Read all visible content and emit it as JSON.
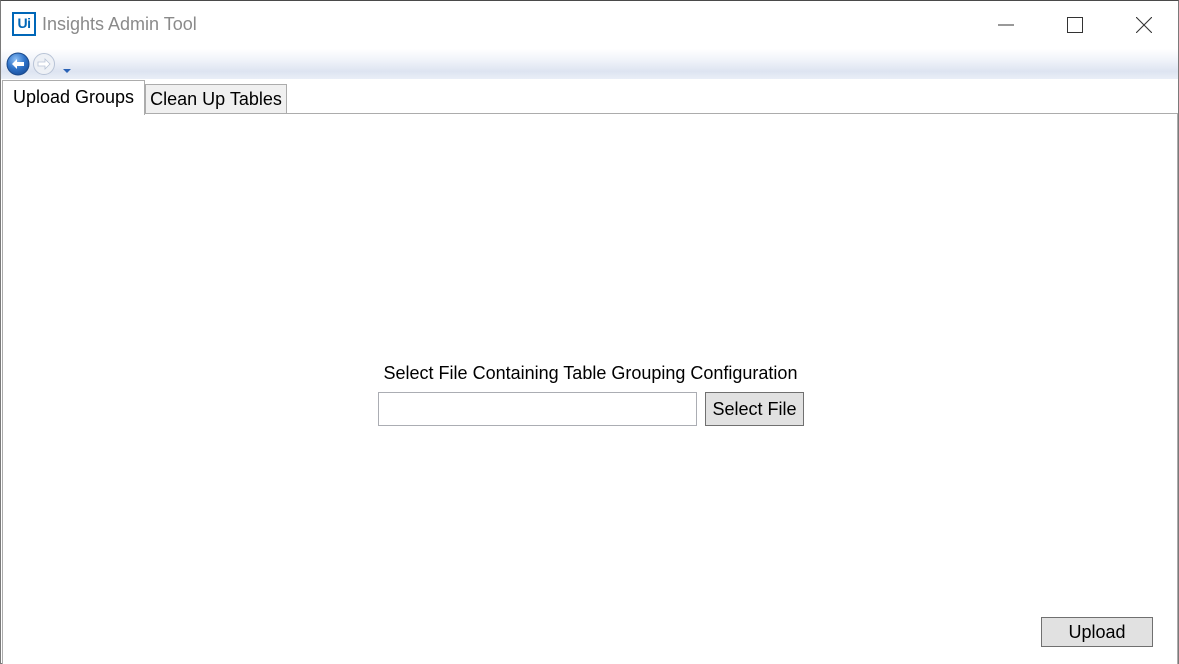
{
  "window": {
    "logo_text": "Ui",
    "title": "Insights Admin Tool"
  },
  "tabs": [
    {
      "label": "Upload Groups",
      "selected": true
    },
    {
      "label": "Clean Up Tables",
      "selected": false
    }
  ],
  "upload_groups": {
    "file_label": "Select File Containing Table Grouping Configuration",
    "file_path_value": "",
    "select_file_label": "Select File",
    "upload_label": "Upload"
  },
  "icons": {
    "back": "arrow-left-circle-icon",
    "forward": "arrow-right-circle-icon",
    "history": "chevron-down-icon",
    "minimize": "minimize-icon",
    "maximize": "maximize-icon",
    "close": "close-icon"
  },
  "colors": {
    "accent": "#0067b8",
    "title_text": "#8a8a8a",
    "button_face": "#e1e1e1",
    "inactive_tab": "#f0f0f0"
  }
}
